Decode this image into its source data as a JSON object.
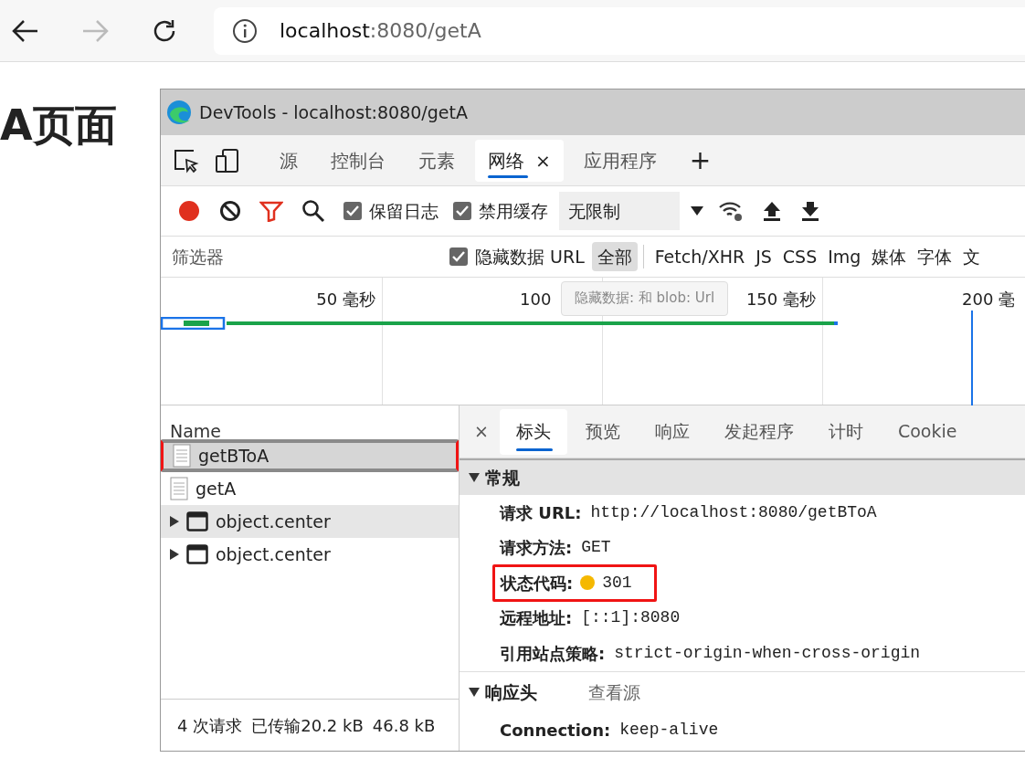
{
  "browser": {
    "address_host": "localhost",
    "address_rest": ":8080/getA"
  },
  "page": {
    "heading": "A页面"
  },
  "devtools": {
    "title": "DevTools - localhost:8080/getA",
    "tabs": [
      {
        "label": "源",
        "selected": false
      },
      {
        "label": "控制台",
        "selected": false
      },
      {
        "label": "元素",
        "selected": false
      },
      {
        "label": "网络",
        "selected": true,
        "close": "×"
      },
      {
        "label": "应用程序",
        "selected": false
      }
    ],
    "add_tab": "+",
    "toolbar": {
      "recording": true,
      "checks": [
        {
          "label": "保留日志",
          "checked": true
        },
        {
          "label": "禁用缓存",
          "checked": true
        }
      ],
      "throttle": "无限制"
    },
    "filter": {
      "placeholder": "筛选器",
      "hide_data": {
        "label": "隐藏数据 URL",
        "checked": true
      },
      "types": [
        {
          "label": "全部",
          "selected": true
        },
        {
          "label": "Fetch/XHR",
          "selected": false
        },
        {
          "label": "JS",
          "selected": false
        },
        {
          "label": "CSS",
          "selected": false
        },
        {
          "label": "Img",
          "selected": false
        },
        {
          "label": "媒体",
          "selected": false
        },
        {
          "label": "字体",
          "selected": false
        },
        {
          "label": "文",
          "selected": false
        }
      ]
    },
    "timeline": {
      "ticks": [
        "50  毫秒",
        "100",
        "150  毫秒",
        "200  毫"
      ],
      "tooltip": "隐藏数据: 和 blob: Url"
    },
    "requests": {
      "column": "Name",
      "rows": [
        {
          "name": "getBToA",
          "kind": "document",
          "selected": true,
          "hovered": false,
          "annotated": true
        },
        {
          "name": "getA",
          "kind": "document",
          "selected": false,
          "hovered": false,
          "annotated": false
        },
        {
          "name": "object.center",
          "kind": "frame",
          "selected": false,
          "hovered": true,
          "annotated": false
        },
        {
          "name": "object.center",
          "kind": "frame",
          "selected": false,
          "hovered": false,
          "annotated": false
        }
      ],
      "summary": [
        "4 次请求",
        "已传输20.2 kB",
        "46.8 kB"
      ]
    },
    "details": {
      "close": "×",
      "tabs": [
        {
          "label": "标头",
          "selected": true
        },
        {
          "label": "预览",
          "selected": false
        },
        {
          "label": "响应",
          "selected": false
        },
        {
          "label": "发起程序",
          "selected": false
        },
        {
          "label": "计时",
          "selected": false
        },
        {
          "label": "Cookie",
          "selected": false
        }
      ],
      "sections": [
        {
          "title": "常规",
          "expanded": true,
          "fields": [
            {
              "label": "请求 URL:",
              "value": "http://localhost:8080/getBToA",
              "annotated": false
            },
            {
              "label": "请求方法:",
              "value": "GET",
              "annotated": false
            },
            {
              "label": "状态代码:",
              "value": "301",
              "color": "#f5b800",
              "annotated": true
            },
            {
              "label": "远程地址:",
              "value": "[::1]:8080",
              "annotated": false
            },
            {
              "label": "引用站点策略:",
              "value": "strict-origin-when-cross-origin",
              "annotated": false
            }
          ]
        },
        {
          "title": "响应头",
          "expanded": true,
          "link": "查看源",
          "fields": [
            {
              "label": "Connection:",
              "value": "keep-alive",
              "annotated": false
            }
          ]
        }
      ]
    }
  }
}
